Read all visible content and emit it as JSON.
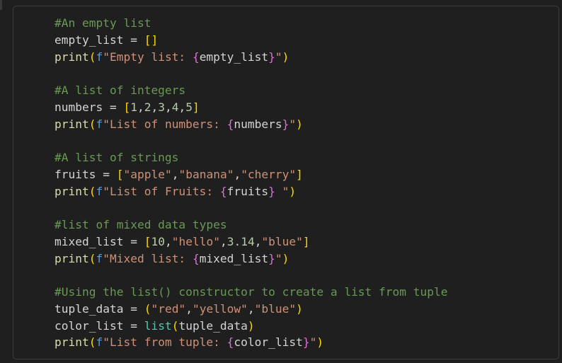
{
  "code_lines": [
    [
      {
        "t": "#An empty list",
        "k": "comment"
      }
    ],
    [
      {
        "t": "empty_list",
        "k": "var"
      },
      {
        "t": " = ",
        "k": "op"
      },
      {
        "t": "[]",
        "k": "bracket"
      }
    ],
    [
      {
        "t": "print",
        "k": "fn"
      },
      {
        "t": "(",
        "k": "paren"
      },
      {
        "t": "f",
        "k": "prefix"
      },
      {
        "t": "\"Empty list: ",
        "k": "str"
      },
      {
        "t": "{",
        "k": "brace"
      },
      {
        "t": "empty_list",
        "k": "var"
      },
      {
        "t": "}",
        "k": "brace"
      },
      {
        "t": "\"",
        "k": "str"
      },
      {
        "t": ")",
        "k": "paren"
      }
    ],
    [],
    [
      {
        "t": "#A list of integers",
        "k": "comment"
      }
    ],
    [
      {
        "t": "numbers",
        "k": "var"
      },
      {
        "t": " = ",
        "k": "op"
      },
      {
        "t": "[",
        "k": "bracket"
      },
      {
        "t": "1",
        "k": "num"
      },
      {
        "t": ",",
        "k": "punc"
      },
      {
        "t": "2",
        "k": "num"
      },
      {
        "t": ",",
        "k": "punc"
      },
      {
        "t": "3",
        "k": "num"
      },
      {
        "t": ",",
        "k": "punc"
      },
      {
        "t": "4",
        "k": "num"
      },
      {
        "t": ",",
        "k": "punc"
      },
      {
        "t": "5",
        "k": "num"
      },
      {
        "t": "]",
        "k": "bracket"
      }
    ],
    [
      {
        "t": "print",
        "k": "fn"
      },
      {
        "t": "(",
        "k": "paren"
      },
      {
        "t": "f",
        "k": "prefix"
      },
      {
        "t": "\"List of numbers: ",
        "k": "str"
      },
      {
        "t": "{",
        "k": "brace"
      },
      {
        "t": "numbers",
        "k": "var"
      },
      {
        "t": "}",
        "k": "brace"
      },
      {
        "t": "\"",
        "k": "str"
      },
      {
        "t": ")",
        "k": "paren"
      }
    ],
    [],
    [
      {
        "t": "#A list of strings",
        "k": "comment"
      }
    ],
    [
      {
        "t": "fruits",
        "k": "var"
      },
      {
        "t": " = ",
        "k": "op"
      },
      {
        "t": "[",
        "k": "bracket"
      },
      {
        "t": "\"apple\"",
        "k": "str"
      },
      {
        "t": ",",
        "k": "punc"
      },
      {
        "t": "\"banana\"",
        "k": "str"
      },
      {
        "t": ",",
        "k": "punc"
      },
      {
        "t": "\"cherry\"",
        "k": "str"
      },
      {
        "t": "]",
        "k": "bracket"
      }
    ],
    [
      {
        "t": "print",
        "k": "fn"
      },
      {
        "t": "(",
        "k": "paren"
      },
      {
        "t": "f",
        "k": "prefix"
      },
      {
        "t": "\"List of Fruits: ",
        "k": "str"
      },
      {
        "t": "{",
        "k": "brace"
      },
      {
        "t": "fruits",
        "k": "var"
      },
      {
        "t": "}",
        "k": "brace"
      },
      {
        "t": " \"",
        "k": "str"
      },
      {
        "t": ")",
        "k": "paren"
      }
    ],
    [],
    [
      {
        "t": "#list of mixed data types",
        "k": "comment"
      }
    ],
    [
      {
        "t": "mixed_list",
        "k": "var"
      },
      {
        "t": " = ",
        "k": "op"
      },
      {
        "t": "[",
        "k": "bracket"
      },
      {
        "t": "10",
        "k": "num"
      },
      {
        "t": ",",
        "k": "punc"
      },
      {
        "t": "\"hello\"",
        "k": "str"
      },
      {
        "t": ",",
        "k": "punc"
      },
      {
        "t": "3.14",
        "k": "num"
      },
      {
        "t": ",",
        "k": "punc"
      },
      {
        "t": "\"blue\"",
        "k": "str"
      },
      {
        "t": "]",
        "k": "bracket"
      }
    ],
    [
      {
        "t": "print",
        "k": "fn"
      },
      {
        "t": "(",
        "k": "paren"
      },
      {
        "t": "f",
        "k": "prefix"
      },
      {
        "t": "\"Mixed list: ",
        "k": "str"
      },
      {
        "t": "{",
        "k": "brace"
      },
      {
        "t": "mixed_list",
        "k": "var"
      },
      {
        "t": "}",
        "k": "brace"
      },
      {
        "t": "\"",
        "k": "str"
      },
      {
        "t": ")",
        "k": "paren"
      }
    ],
    [],
    [
      {
        "t": "#Using the list() constructor to create a list from tuple",
        "k": "comment"
      }
    ],
    [
      {
        "t": "tuple_data",
        "k": "var"
      },
      {
        "t": " = ",
        "k": "op"
      },
      {
        "t": "(",
        "k": "paren"
      },
      {
        "t": "\"red\"",
        "k": "str"
      },
      {
        "t": ",",
        "k": "punc"
      },
      {
        "t": "\"yellow\"",
        "k": "str"
      },
      {
        "t": ",",
        "k": "punc"
      },
      {
        "t": "\"blue\"",
        "k": "str"
      },
      {
        "t": ")",
        "k": "paren"
      }
    ],
    [
      {
        "t": "color_list",
        "k": "var"
      },
      {
        "t": " = ",
        "k": "op"
      },
      {
        "t": "list",
        "k": "builtin"
      },
      {
        "t": "(",
        "k": "paren"
      },
      {
        "t": "tuple_data",
        "k": "var"
      },
      {
        "t": ")",
        "k": "paren"
      }
    ],
    [
      {
        "t": "print",
        "k": "fn"
      },
      {
        "t": "(",
        "k": "paren"
      },
      {
        "t": "f",
        "k": "prefix"
      },
      {
        "t": "\"List from tuple: ",
        "k": "str"
      },
      {
        "t": "{",
        "k": "brace"
      },
      {
        "t": "color_list",
        "k": "var"
      },
      {
        "t": "}",
        "k": "brace"
      },
      {
        "t": "\"",
        "k": "str"
      },
      {
        "t": ")",
        "k": "paren"
      }
    ]
  ],
  "colors": {
    "background": "#1f1f1f",
    "cell_border": "#3b3b3b",
    "comment": "#6a9955",
    "string": "#ce9178",
    "number": "#b5cea8",
    "function": "#dcdcaa",
    "builtin": "#4ec9b0",
    "fstring_prefix": "#569cd6",
    "bracket": "#ffd700",
    "brace": "#da70d6",
    "default_text": "#d4d4d4"
  }
}
